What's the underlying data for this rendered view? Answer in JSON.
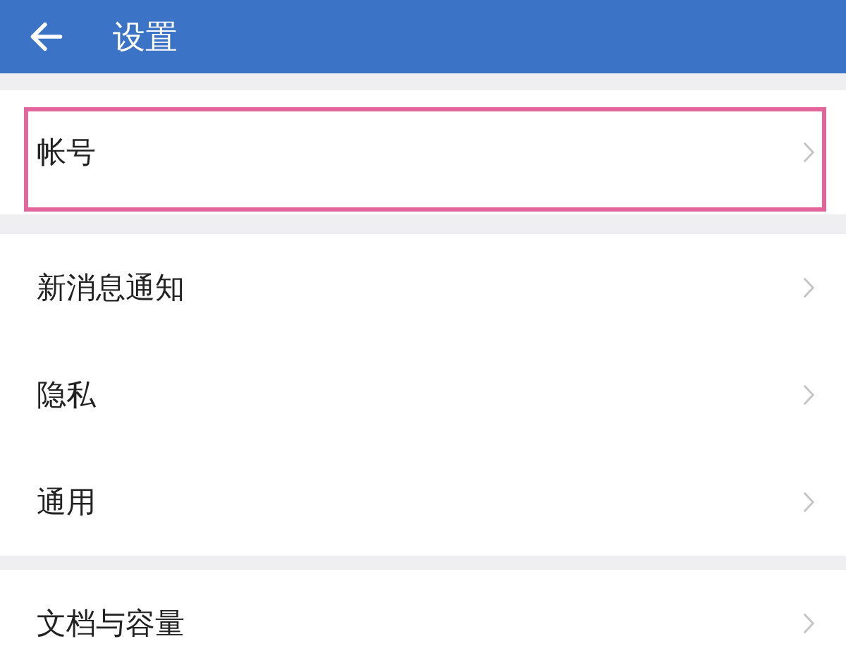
{
  "header": {
    "title": "设置"
  },
  "groups": [
    {
      "items": [
        {
          "label": "帐号",
          "highlighted": true
        }
      ]
    },
    {
      "items": [
        {
          "label": "新消息通知",
          "highlighted": false
        },
        {
          "label": "隐私",
          "highlighted": false
        },
        {
          "label": "通用",
          "highlighted": false
        }
      ]
    },
    {
      "items": [
        {
          "label": "文档与容量",
          "highlighted": false
        }
      ]
    }
  ]
}
